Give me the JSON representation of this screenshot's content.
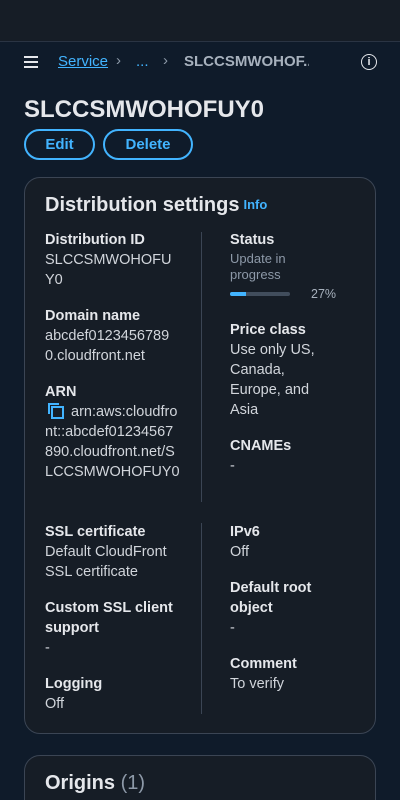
{
  "breadcrumb": {
    "service": "Service",
    "ellipsis": "...",
    "current": "SLCCSMWOHOF..."
  },
  "page": {
    "title": "SLCCSMWOHOFUY0",
    "edit_label": "Edit",
    "delete_label": "Delete"
  },
  "distribution_settings": {
    "title": "Distribution settings",
    "info": "Info",
    "distribution_id": {
      "label": "Distribution ID",
      "value": "SLCCSMWOHOFUY0"
    },
    "domain_name": {
      "label": "Domain name",
      "value": "abcdef01234567890.cloudfront.net"
    },
    "arn": {
      "label": "ARN",
      "value": "arn:aws:cloudfront::abcdef01234567890.cloudfront.net/SLCCSMWOHOFUY0"
    },
    "status": {
      "label": "Status",
      "value": "Update in progress",
      "progress": 27,
      "progress_text": "27%"
    },
    "price_class": {
      "label": "Price class",
      "value": "Use only US, Canada, Europe, and Asia"
    },
    "cnames": {
      "label": "CNAMEs",
      "value": "-"
    },
    "ssl_certificate": {
      "label": "SSL certificate",
      "value": "Default CloudFront SSL certificate"
    },
    "custom_ssl": {
      "label": "Custom SSL client support",
      "value": "-"
    },
    "logging": {
      "label": "Logging",
      "value": "Off"
    },
    "ipv6": {
      "label": "IPv6",
      "value": "Off"
    },
    "default_root_object": {
      "label": "Default root object",
      "value": "-"
    },
    "comment": {
      "label": "Comment",
      "value": "To verify"
    }
  },
  "origins": {
    "title": "Origins",
    "count": "(1)"
  },
  "icons": {
    "menu": "hamburger-icon",
    "chevron": "chevron-right-icon",
    "info": "info-icon",
    "copy": "copy-icon"
  },
  "colors": {
    "accent": "#42b4ff",
    "background": "#0f1b2a",
    "card": "#161d26"
  }
}
